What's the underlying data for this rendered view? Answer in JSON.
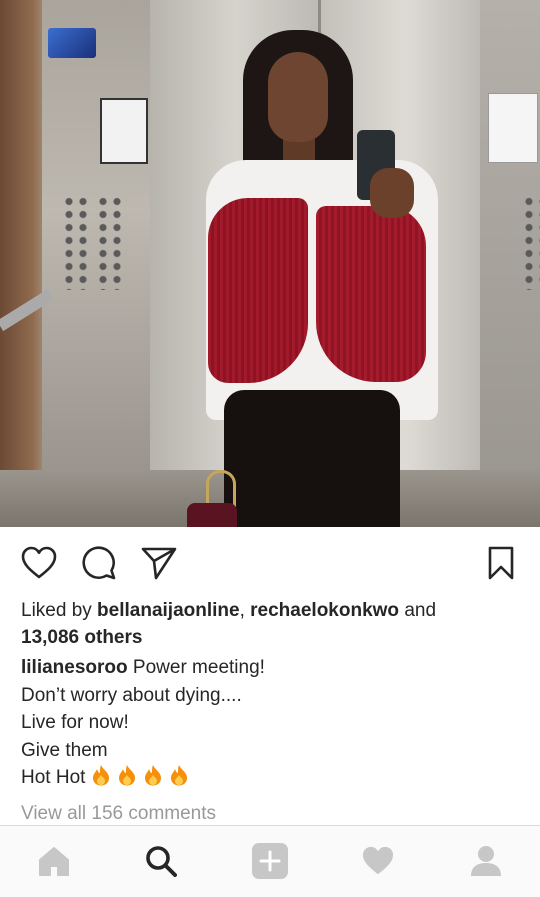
{
  "post": {
    "liked_by_prefix": "Liked by ",
    "liked_user_1": "bellanaijaonline",
    "liked_sep": ", ",
    "liked_user_2": "rechaelokonkwo",
    "liked_and": " and",
    "liked_others": "13,086 others",
    "caption_user": "lilianesoroo",
    "caption_line_1": " Power meeting!",
    "caption_line_2": "Don’t worry about dying....",
    "caption_line_3": "Live for now!",
    "caption_line_4": "Give them",
    "caption_line_5_text": "Hot Hot ",
    "caption_line_5_emoji_count": 4,
    "caption_emoji_icon": "fire-emoji",
    "view_comments": "View all 156 comments"
  },
  "icons": {
    "like": "heart-outline-icon",
    "comment": "speech-bubble-icon",
    "share": "paper-plane-icon",
    "save": "bookmark-icon"
  },
  "nav": {
    "items": [
      "home-icon",
      "search-icon",
      "add-post-icon",
      "activity-heart-icon",
      "profile-icon"
    ],
    "active": "search-icon"
  },
  "colors": {
    "text": "#262626",
    "muted": "#999999",
    "inactive_nav": "#c7c7c7",
    "active_nav": "#262626"
  }
}
